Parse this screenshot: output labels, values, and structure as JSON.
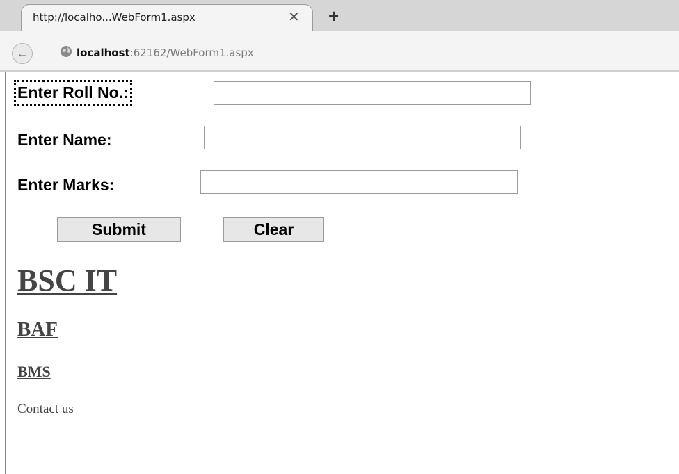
{
  "browser": {
    "tab_title": "http://localho...WebForm1.aspx",
    "close_glyph": "✕",
    "new_tab_glyph": "+",
    "back_glyph": "←",
    "url_host": "localhost",
    "url_rest": ":62162/WebForm1.aspx"
  },
  "form": {
    "roll_label": "Enter Roll No.:",
    "roll_value": "",
    "name_label": "Enter Name:",
    "name_value": "",
    "marks_label": "Enter Marks:",
    "marks_value": "",
    "submit_label": "Submit",
    "clear_label": "Clear"
  },
  "links": {
    "bscit": "BSC IT",
    "baf": "BAF",
    "bms": "BMS",
    "contact": "Contact us"
  },
  "icons": {
    "back": "back-arrow-icon",
    "globe": "globe-icon",
    "close": "close-icon",
    "new_tab": "plus-icon"
  }
}
